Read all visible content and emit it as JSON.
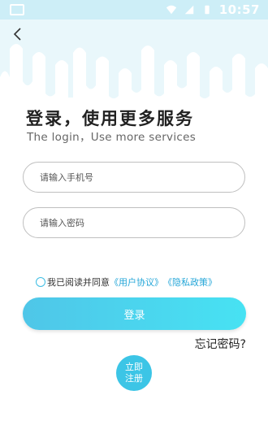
{
  "status_bar": {
    "time": "10:57",
    "icons": [
      "message-icon",
      "wifi-icon",
      "signal-icon",
      "battery-icon"
    ]
  },
  "header": {
    "back_icon": "back-chevron-icon"
  },
  "title": "登录，使用更多服务",
  "subtitle": "The login，Use more services",
  "phone_input": {
    "placeholder": "请输入手机号"
  },
  "password_input": {
    "placeholder": "请输入密码"
  },
  "agreement": {
    "prefix": "我已阅读并同意",
    "user_agreement": "《用户协议》",
    "privacy_policy": "《隐私政策》"
  },
  "login_button": "登录",
  "forgot_password": "忘记密码?",
  "register_button": {
    "line1": "立即",
    "line2": "注册"
  },
  "colors": {
    "accent": "#3cc5e6",
    "header_bg": "#e8f7fb",
    "link": "#24a6d8"
  }
}
